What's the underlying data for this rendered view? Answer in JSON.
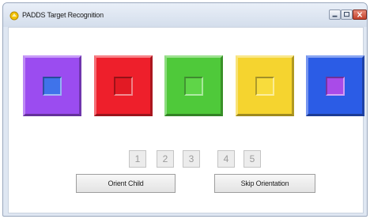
{
  "window": {
    "title": "PADDS Target Recognition",
    "icon": "app-icon"
  },
  "titlebar_controls": [
    {
      "name": "minimize-button",
      "icon": "minimize-icon"
    },
    {
      "name": "maximize-button",
      "icon": "maximize-icon"
    },
    {
      "name": "close-button",
      "icon": "close-icon"
    }
  ],
  "targets": [
    {
      "name": "target-purple",
      "outer_color": "#9b4cf0",
      "inner_color": "#3f73ea"
    },
    {
      "name": "target-red",
      "outer_color": "#ee1f2b",
      "inner_color": "#e21a24"
    },
    {
      "name": "target-green",
      "outer_color": "#4fc93a",
      "inner_color": "#5fd548"
    },
    {
      "name": "target-yellow",
      "outer_color": "#f5d42f",
      "inner_color": "#f8dc3c"
    },
    {
      "name": "target-blue",
      "outer_color": "#2b5ce6",
      "inner_color": "#a94be8"
    }
  ],
  "number_buttons": [
    "1",
    "2",
    "3",
    "4",
    "5"
  ],
  "buttons": {
    "orient_child": "Orient Child",
    "skip_orientation": "Skip Orientation"
  }
}
